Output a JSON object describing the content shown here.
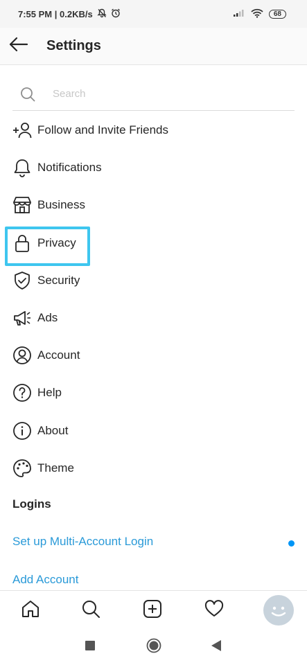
{
  "status_bar": {
    "time_speed": "7:55 PM | 0.2KB/s",
    "battery": "68"
  },
  "header": {
    "title": "Settings"
  },
  "search": {
    "placeholder": "Search"
  },
  "menu": {
    "items": [
      {
        "label": "Follow and Invite Friends",
        "icon": "add-person-icon"
      },
      {
        "label": "Notifications",
        "icon": "bell-icon"
      },
      {
        "label": "Business",
        "icon": "storefront-icon"
      },
      {
        "label": "Privacy",
        "icon": "lock-icon"
      },
      {
        "label": "Security",
        "icon": "shield-check-icon"
      },
      {
        "label": "Ads",
        "icon": "megaphone-icon"
      },
      {
        "label": "Account",
        "icon": "account-circle-icon"
      },
      {
        "label": "Help",
        "icon": "help-circle-icon"
      },
      {
        "label": "About",
        "icon": "info-circle-icon"
      },
      {
        "label": "Theme",
        "icon": "palette-icon"
      }
    ],
    "highlighted": "Privacy"
  },
  "logins": {
    "section_title": "Logins",
    "multi_account": "Set up Multi-Account Login",
    "add_account": "Add Account"
  },
  "colors": {
    "highlight": "#3ec6ef",
    "link": "#2a9ad8",
    "dot": "#0095f6"
  }
}
